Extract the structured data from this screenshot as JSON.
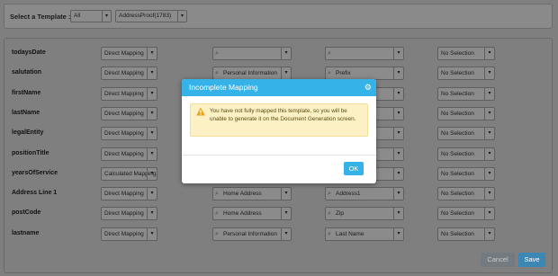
{
  "template": {
    "label": "Select a Template :",
    "filter_value": "All",
    "template_value": "AddressProof(1783)"
  },
  "rows": [
    {
      "field": "todaysDate",
      "mapping": "Direct Mapping",
      "source": "",
      "target": "",
      "selection": "No Selection"
    },
    {
      "field": "salutation",
      "mapping": "Direct Mapping",
      "source": "Personal Information",
      "target": "Prefix",
      "selection": "No Selection"
    },
    {
      "field": "firstName",
      "mapping": "Direct Mapping",
      "source": "",
      "target": "",
      "selection": "No Selection"
    },
    {
      "field": "lastName",
      "mapping": "Direct Mapping",
      "source": "",
      "target": "",
      "selection": "No Selection"
    },
    {
      "field": "legalEntity",
      "mapping": "Direct Mapping",
      "source": "",
      "target": "Entity Na...",
      "selection": "No Selection"
    },
    {
      "field": "positionTitle",
      "mapping": "Direct Mapping",
      "source": "",
      "target": "on Name",
      "selection": "No Selection"
    },
    {
      "field": "yearsOfService",
      "mapping": "Calculated Mapping",
      "source": "",
      "target": "",
      "selection": "No Selection"
    },
    {
      "field": "Address Line 1",
      "mapping": "Direct Mapping",
      "source": "Home Address",
      "target": "Address1",
      "selection": "No Selection"
    },
    {
      "field": "postCode",
      "mapping": "Direct Mapping",
      "source": "Home Address",
      "target": "Zip",
      "selection": "No Selection"
    },
    {
      "field": "lastname",
      "mapping": "Direct Mapping",
      "source": "Personal Information",
      "target": "Last Name",
      "selection": "No Selection"
    }
  ],
  "actions": {
    "cancel": "Cancel",
    "save": "Save"
  },
  "modal": {
    "title": "Incomplete Mapping",
    "message": "You have not fully mapped this template, so you will be unable to generate it on the Document Generation screen.",
    "ok": "OK"
  },
  "icons": {
    "caret": "chevron-down-icon",
    "search": "search-icon",
    "settings": "gear-icon",
    "warning": "warning-icon"
  },
  "colors": {
    "header": "#35b2e8",
    "save": "#3d87b5",
    "warning_bg": "#fcf1c5"
  }
}
